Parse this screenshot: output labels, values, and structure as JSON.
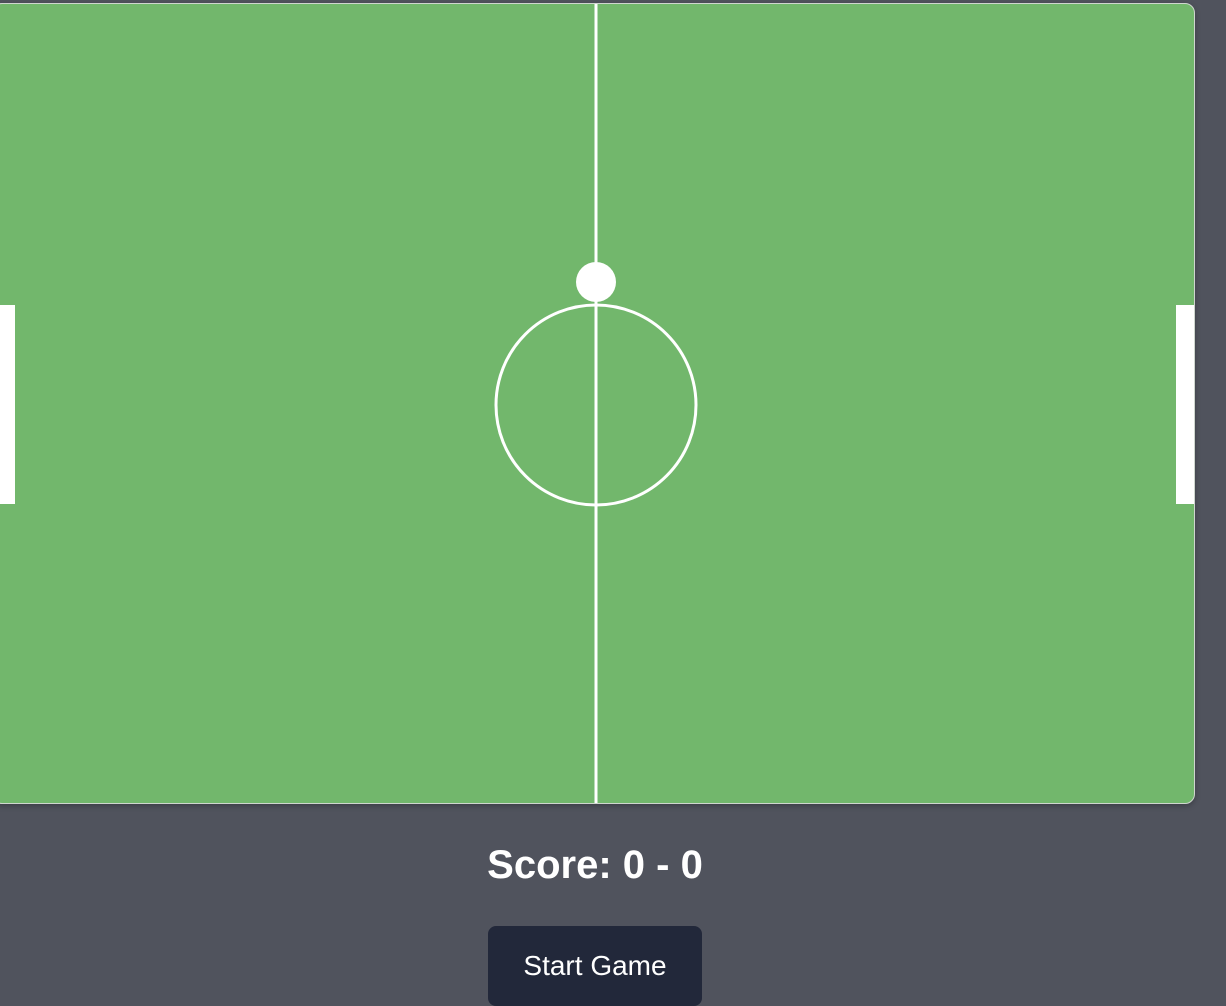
{
  "game": {
    "score_text": "Score: 0 - 0",
    "start_button_label": "Start Game"
  },
  "colors": {
    "background": "#50535d",
    "field": "#72b76c",
    "lines": "#ffffff",
    "button": "#22283a"
  }
}
